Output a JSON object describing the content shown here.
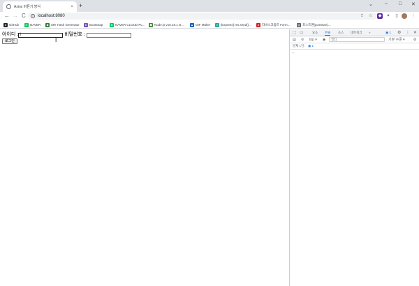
{
  "tab": {
    "title": "Axios 버튼기 방식",
    "close": "×"
  },
  "newtab": "+",
  "window_controls": {
    "chevron": "⌄",
    "minimize": "–",
    "maximize": "□",
    "close": "✕"
  },
  "toolbar": {
    "back": "←",
    "forward": "→",
    "reload": "C",
    "url": "localhost:8080",
    "share": "⇪",
    "star": "☆"
  },
  "extensions": {
    "puzzle": "✦",
    "sidebar": "▯",
    "more": "⋮"
  },
  "bookmarks": [
    {
      "label": "GitHub",
      "color": "#24292e",
      "glyph": "●"
    },
    {
      "label": "NAVER",
      "color": "#03c75a",
      "glyph": "N"
    },
    {
      "label": "SRI Hash Generator",
      "color": "#2e7d32",
      "glyph": "◆"
    },
    {
      "label": "Bootstrap",
      "color": "#7952b3",
      "glyph": "B"
    },
    {
      "label": "NAVER CLOUD PL...",
      "color": "#03c75a",
      "glyph": "◈"
    },
    {
      "label": "Node.js v16.18.1 D...",
      "color": "#43853d",
      "glyph": "⬢"
    },
    {
      "label": "GIF Maker",
      "color": "#1565c0",
      "glyph": "▲"
    },
    {
      "label": "[Express] res.send()...",
      "color": "#26a69a",
      "glyph": "V"
    },
    {
      "label": "자바스크립트 Form...",
      "color": "#c62828",
      "glyph": "●"
    },
    {
      "label": "포스트맨(postman)...",
      "color": "#5f6368",
      "glyph": "▤"
    }
  ],
  "page": {
    "id_label": "아이디 :",
    "id_value": "I",
    "pw_label": "비밀번호 :",
    "pw_value": "",
    "login_button": "로그인",
    "cursor": "I"
  },
  "devtools": {
    "inspect": "⬚",
    "device": "▭",
    "tabs": [
      "요소",
      "콘솔",
      "소스",
      "네트워크"
    ],
    "active_tab": "콘솔",
    "more_tabs": "»",
    "badge": "1",
    "settings": "⚙",
    "menu": "⋮",
    "close": "✕",
    "console_bar": {
      "sidebar": "▤",
      "clear": "⊘",
      "context": "top ▾",
      "eye": "◉",
      "filter_placeholder": "필터",
      "levels": "기본 수준 ▾",
      "settings": "⚙"
    },
    "issues": {
      "label": "문제 1건:",
      "badge": "1"
    },
    "prompt": "›"
  }
}
